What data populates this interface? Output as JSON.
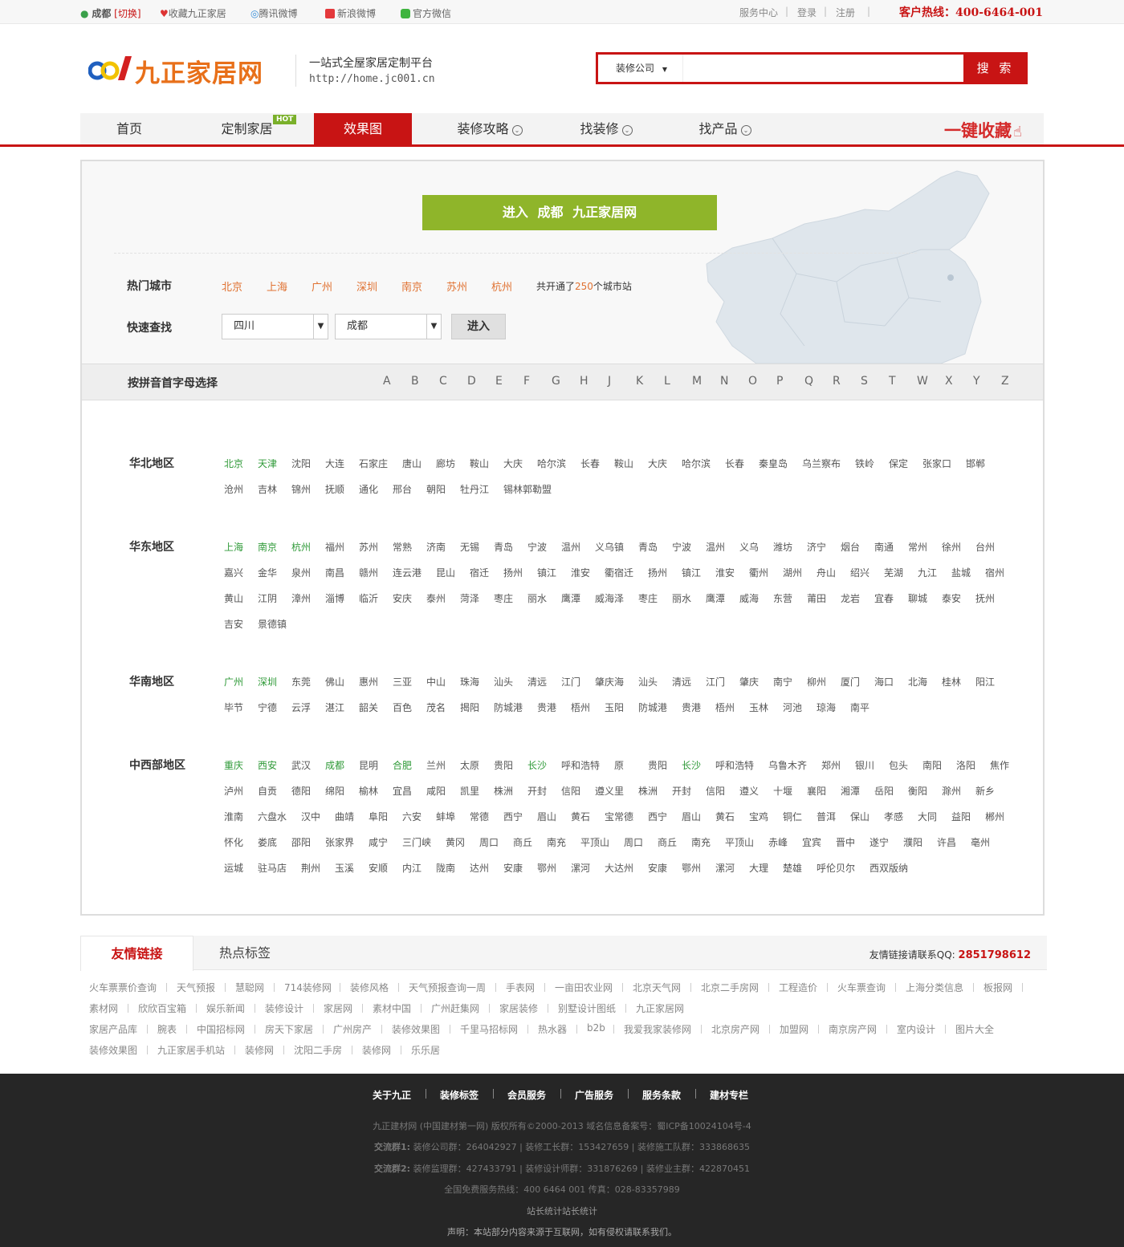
{
  "topbar": {
    "location": "成都",
    "switch": "[切换]",
    "favorite": "收藏九正家居",
    "tencent": "腾讯微博",
    "sina": "新浪微博",
    "wechat": "官方微信",
    "service": "服务中心",
    "login": "登录",
    "register": "注册",
    "hotline": "客户热线：400-6464-001"
  },
  "header": {
    "logo_text": "九正家居网",
    "slogan": "一站式全屋家居定制平台",
    "url": "http://home.jc001.cn",
    "search_category": "装修公司",
    "search_placeholder": "",
    "search_button": "搜 索"
  },
  "nav": {
    "items": [
      "首页",
      "定制家居",
      "效果图",
      "装修攻略",
      "找装修",
      "找产品"
    ],
    "hot_badge": "HOT",
    "favorite": "一键收藏"
  },
  "city_select": {
    "enter_button": "进入  成都  九正家居网",
    "hot_label": "热门城市",
    "hot_cities": [
      "北京",
      "上海",
      "广州",
      "深圳",
      "南京",
      "苏州",
      "杭州"
    ],
    "count_prefix": "共开通了",
    "count": "250",
    "count_suffix": "个城市站",
    "quick_label": "快速查找",
    "province": "四川",
    "city": "成都",
    "go_button": "进入",
    "pinyin_label": "按拼音首字母选择",
    "letters": [
      "A",
      "B",
      "C",
      "D",
      "E",
      "F",
      "G",
      "H",
      "J",
      "K",
      "L",
      "M",
      "N",
      "O",
      "P",
      "Q",
      "R",
      "S",
      "T",
      "W",
      "X",
      "Y",
      "Z"
    ]
  },
  "regions": [
    {
      "name": "华北地区",
      "rows": [
        [
          "北京",
          "天津",
          "沈阳",
          "大连",
          "石家庄",
          "唐山",
          "廊坊",
          "鞍山",
          "大庆",
          "哈尔滨",
          "长春",
          "鞍山",
          "大庆",
          "哈尔滨",
          "长春",
          "秦皇岛",
          "乌兰察布",
          "铁岭",
          "保定",
          "张家口",
          "邯郸"
        ],
        [
          "沧州",
          "吉林",
          "锦州",
          "抚顺",
          "通化",
          "邢台",
          "朝阳",
          "牡丹江",
          "锡林郭勒盟"
        ]
      ],
      "highlight": [
        "北京",
        "天津"
      ]
    },
    {
      "name": "华东地区",
      "rows": [
        [
          "上海",
          "南京",
          "杭州",
          "福州",
          "苏州",
          "常熟",
          "济南",
          "无锡",
          "青岛",
          "宁波",
          "温州",
          "义乌镇",
          "青岛",
          "宁波",
          "温州",
          "义乌",
          "潍坊",
          "济宁",
          "烟台",
          "南通",
          "常州",
          "徐州",
          "台州"
        ],
        [
          "嘉兴",
          "金华",
          "泉州",
          "南昌",
          "赣州",
          "连云港",
          "昆山",
          "宿迁",
          "扬州",
          "镇江",
          "淮安",
          "衢宿迁",
          "扬州",
          "镇江",
          "淮安",
          "衢州",
          "湖州",
          "舟山",
          "绍兴",
          "芜湖",
          "九江",
          "盐城",
          "宿州"
        ],
        [
          "黄山",
          "江阴",
          "漳州",
          "淄博",
          "临沂",
          "安庆",
          "泰州",
          "菏泽",
          "枣庄",
          "丽水",
          "鹰潭",
          "威海泽",
          "枣庄",
          "丽水",
          "鹰潭",
          "威海",
          "东营",
          "莆田",
          "龙岩",
          "宜春",
          "聊城",
          "泰安",
          "抚州"
        ],
        [
          "吉安",
          "景德镇"
        ]
      ],
      "highlight": [
        "上海",
        "南京",
        "杭州"
      ]
    },
    {
      "name": "华南地区",
      "rows": [
        [
          "广州",
          "深圳",
          "东莞",
          "佛山",
          "惠州",
          "三亚",
          "中山",
          "珠海",
          "汕头",
          "清远",
          "江门",
          "肇庆海",
          "汕头",
          "清远",
          "江门",
          "肇庆",
          "南宁",
          "柳州",
          "厦门",
          "海口",
          "北海",
          "桂林",
          "阳江"
        ],
        [
          "毕节",
          "宁德",
          "云浮",
          "湛江",
          "韶关",
          "百色",
          "茂名",
          "揭阳",
          "防城港",
          "贵港",
          "梧州",
          "玉阳",
          "防城港",
          "贵港",
          "梧州",
          "玉林",
          "河池",
          "琼海",
          "南平"
        ]
      ],
      "highlight": [
        "广州",
        "深圳"
      ]
    },
    {
      "name": "中西部地区",
      "rows": [
        [
          "重庆",
          "西安",
          "武汉",
          "成都",
          "昆明",
          "合肥",
          "兰州",
          "太原",
          "贵阳",
          "长沙",
          "呼和浩特",
          "原",
          "贵阳",
          "长沙",
          "呼和浩特",
          "乌鲁木齐",
          "郑州",
          "银川",
          "包头",
          "南阳",
          "洛阳",
          "焦作"
        ],
        [
          "泸州",
          "自贡",
          "德阳",
          "绵阳",
          "榆林",
          "宜昌",
          "咸阳",
          "凯里",
          "株洲",
          "开封",
          "信阳",
          "遵义里",
          "株洲",
          "开封",
          "信阳",
          "遵义",
          "十堰",
          "襄阳",
          "湘潭",
          "岳阳",
          "衡阳",
          "滁州",
          "新乡"
        ],
        [
          "淮南",
          "六盘水",
          "汉中",
          "曲靖",
          "阜阳",
          "六安",
          "蚌埠",
          "常德",
          "西宁",
          "眉山",
          "黄石",
          "宝常德",
          "西宁",
          "眉山",
          "黄石",
          "宝鸡",
          "铜仁",
          "普洱",
          "保山",
          "孝感",
          "大同",
          "益阳",
          "郴州"
        ],
        [
          "怀化",
          "娄底",
          "邵阳",
          "张家界",
          "咸宁",
          "三门峡",
          "黄冈",
          "周口",
          "商丘",
          "南充",
          "平顶山",
          "周口",
          "商丘",
          "南充",
          "平顶山",
          "赤峰",
          "宜宾",
          "晋中",
          "遂宁",
          "濮阳",
          "许昌",
          "亳州"
        ],
        [
          "运城",
          "驻马店",
          "荆州",
          "玉溪",
          "安顺",
          "内江",
          "陇南",
          "达州",
          "安康",
          "鄂州",
          "漯河",
          "大达州",
          "安康",
          "鄂州",
          "漯河",
          "大理",
          "楚雄",
          "呼伦贝尔",
          "西双版纳"
        ]
      ],
      "highlight": [
        "重庆",
        "西安",
        "成都",
        "合肥",
        "长沙"
      ]
    }
  ],
  "links": {
    "tab_friend": "友情链接",
    "tab_hot": "热点标签",
    "qq_label": "友情链接请联系QQ:",
    "qq": "2851798612",
    "rows": [
      [
        "火车票票价查询",
        "天气预报",
        "慧聪网",
        "714装修网",
        "装修风格",
        "天气预报查询一周",
        "手表网",
        "一亩田农业网",
        "北京天气网",
        "北京二手房网",
        "工程造价",
        "火车票查询",
        "上海分类信息",
        "板报网"
      ],
      [
        "素材网",
        "欣欣百宝箱",
        "娱乐新闻",
        "装修设计",
        "家居网",
        "素材中国",
        "广州赶集网",
        "家居装修",
        "别墅设计图纸",
        "九正家居网"
      ],
      [
        "家居产品库",
        "腕表",
        "中国招标网",
        "房天下家居",
        "广州房产",
        "装修效果图",
        "千里马招标网",
        "热水器",
        "b2b",
        "我爱我家装修网",
        "北京房产网",
        "加盟网",
        "南京房产网",
        "室内设计",
        "图片大全"
      ],
      [
        "装修效果图",
        "九正家居手机站",
        "装修网",
        "沈阳二手房",
        "装修网",
        "乐乐居"
      ]
    ]
  },
  "footer": {
    "nav": [
      "关于九正",
      "装修标签",
      "会员服务",
      "广告服务",
      "服务条款",
      "建材专栏"
    ],
    "copyright": "九正建材网 (中国建材第一网) 版权所有©2000-2013   域名信息备案号：蜀ICP备10024104号-4",
    "group1_label": "交流群1:",
    "group1": "装修公司群：264042927 | 装修工长群：153427659 | 装修施工队群：333868635",
    "group2_label": "交流群2:",
    "group2": "装修监理群：427433791 | 装修设计师群：331876269 | 装修业主群：422870451",
    "service": "全国免费服务热线：400 6464 001 传真：028-83357989",
    "stats": "站长统计站长统计",
    "notice": "声明：本站部分内容来源于互联网，如有侵权请联系我们。"
  },
  "colors": {
    "brand_red": "#c81414",
    "green_button": "#8fb52a",
    "hot_orange": "#e07232",
    "city_green": "#2f9a38",
    "footer_bg": "#262626"
  }
}
